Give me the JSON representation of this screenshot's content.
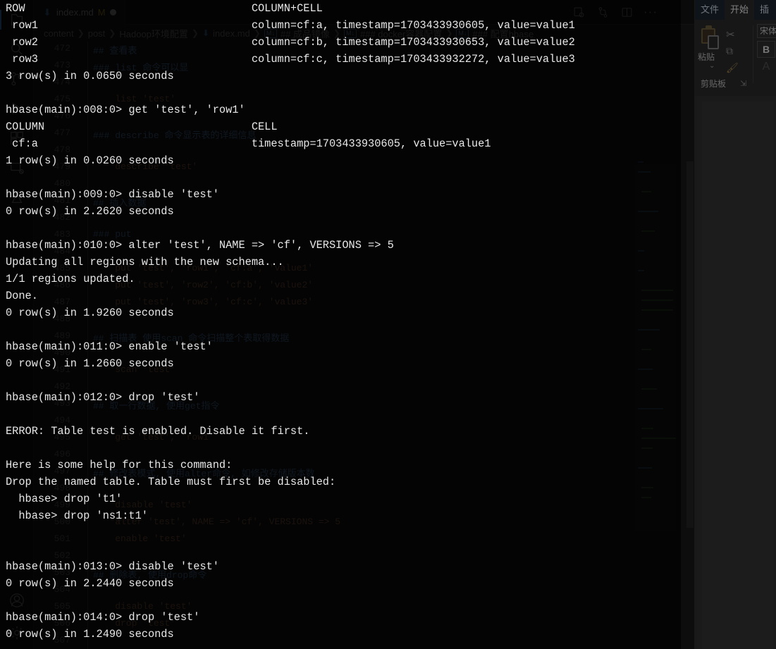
{
  "office": {
    "tabs": [
      {
        "label": "文件",
        "active": false
      },
      {
        "label": "开始",
        "active": true
      },
      {
        "label": "插",
        "active": false
      }
    ],
    "clipboard": {
      "paste_label": "粘贴",
      "paste_chevron": "⌄",
      "group_label": "剪贴板",
      "dialog_launcher": "⇲",
      "cut_icon": "scissors-icon",
      "copy_icon": "copy-icon",
      "format_painter_icon": "format-painter-icon"
    },
    "font": {
      "family_value": "宋体",
      "bold_label": "B",
      "font_color_label": "A"
    }
  },
  "vscode": {
    "activity_bar": {
      "items": [
        {
          "name": "explorer",
          "icon": "files-icon"
        },
        {
          "name": "search",
          "icon": "search-icon"
        },
        {
          "name": "source-control",
          "icon": "source-control-icon"
        },
        {
          "name": "run-debug",
          "icon": "run-debug-icon"
        },
        {
          "name": "extensions",
          "icon": "extensions-icon"
        },
        {
          "name": "remote-explorer",
          "icon": "remote-explorer-icon"
        },
        {
          "name": "testing",
          "icon": "beaker-icon"
        }
      ],
      "bottom_items": [
        {
          "name": "accounts",
          "icon": "account-icon"
        },
        {
          "name": "settings",
          "icon": "gear-icon"
        }
      ]
    },
    "tab": {
      "file_icon": "markdown-icon",
      "name": "index.md",
      "modified_badge": "M",
      "dirty_indicator": "●"
    },
    "editor_actions": [
      {
        "name": "open-preview",
        "icon": "preview-icon"
      },
      {
        "name": "source-control-graph",
        "icon": "git-compare-icon"
      },
      {
        "name": "split-editor",
        "icon": "split-editor-icon"
      },
      {
        "name": "more-actions",
        "icon": "ellipsis-icon",
        "label": "···"
      }
    ],
    "breadcrumb": [
      {
        "label": "content",
        "type": "folder"
      },
      {
        "label": "post",
        "type": "folder"
      },
      {
        "label": "Hadoop环境配置",
        "type": "folder"
      },
      {
        "label": "index.md",
        "type": "file"
      },
      {
        "label": "## 成品镜像",
        "type": "symbol"
      },
      {
        "label": "### docker容器配置",
        "type": "symbol"
      },
      {
        "label": "### 配置hbase",
        "type": "symbol"
      }
    ],
    "editor_lines": [
      {
        "num": "472",
        "text": "## 查看表",
        "cls": "c-head"
      },
      {
        "num": "473",
        "text": "### list 命令可以显",
        "cls": "c-head"
      },
      {
        "num": "474",
        "text": "",
        "cls": "c-txt"
      },
      {
        "num": "475",
        "text": "    list 'test'",
        "cls": "c-str"
      },
      {
        "num": "476",
        "text": "",
        "cls": "c-txt"
      },
      {
        "num": "477",
        "text": "### describe 命令显示表的详细信息",
        "cls": "c-head"
      },
      {
        "num": "478",
        "text": "",
        "cls": "c-txt"
      },
      {
        "num": "479",
        "text": "    describe 'test'",
        "cls": "c-str"
      },
      {
        "num": "480",
        "text": "",
        "cls": "c-txt"
      },
      {
        "num": "481",
        "text": "## 插入数据",
        "cls": "c-head"
      },
      {
        "num": "482",
        "text": "",
        "cls": "c-txt"
      },
      {
        "num": "483",
        "text": "### put",
        "cls": "c-head"
      },
      {
        "num": "484",
        "text": "",
        "cls": "c-txt"
      },
      {
        "num": "485",
        "text": "    put 'test', 'row1', 'cf:a', 'value1'",
        "cls": "c-str"
      },
      {
        "num": "486",
        "text": "    put 'test', 'row2', 'cf:b', 'value2'",
        "cls": "c-str"
      },
      {
        "num": "487",
        "text": "    put 'test', 'row3', 'cf:c', 'value3'",
        "cls": "c-str"
      },
      {
        "num": "488",
        "text": "",
        "cls": "c-txt"
      },
      {
        "num": "489",
        "text": "## 扫描表 使用scan 命令扫描整个表取得数据",
        "cls": "c-head"
      },
      {
        "num": "490",
        "text": "",
        "cls": "c-txt"
      },
      {
        "num": "491",
        "text": "    scan 'test'",
        "cls": "c-str"
      },
      {
        "num": "492",
        "text": "",
        "cls": "c-txt"
      },
      {
        "num": "493",
        "text": "## 取一行数据, 使用get指令",
        "cls": "c-head"
      },
      {
        "num": "494",
        "text": "",
        "cls": "c-txt"
      },
      {
        "num": "495",
        "text": "    get 'test', 'row1'",
        "cls": "c-str"
      },
      {
        "num": "496",
        "text": "",
        "cls": "c-txt"
      },
      {
        "num": "497",
        "text": "## 修改表模式, 使用alter命令, 如修改存储版本数",
        "cls": "c-head"
      },
      {
        "num": "498",
        "text": "",
        "cls": "c-txt"
      },
      {
        "num": "499",
        "text": "    disable 'test'",
        "cls": "c-str"
      },
      {
        "num": "500",
        "text": "    alter 'test', NAME => 'cf', VERSIONS => 5",
        "cls": "c-str"
      },
      {
        "num": "501",
        "text": "    enable 'test'",
        "cls": "c-str"
      },
      {
        "num": "502",
        "text": "",
        "cls": "c-txt"
      },
      {
        "num": "503",
        "text": "## 删除表, 使用drop命令",
        "cls": "c-head"
      },
      {
        "num": "504",
        "text": "",
        "cls": "c-txt"
      },
      {
        "num": "505",
        "text": "    disable 'test'",
        "cls": "c-str"
      },
      {
        "num": "506",
        "text": "    drop 'test'",
        "cls": "c-str"
      },
      {
        "num": "507",
        "text": "",
        "cls": "c-txt"
      }
    ]
  },
  "terminal": {
    "lines": [
      "ROW                                   COLUMN+CELL",
      " row1                                 column=cf:a, timestamp=1703433930605, value=value1",
      " row2                                 column=cf:b, timestamp=1703433930653, value=value2",
      " row3                                 column=cf:c, timestamp=1703433932272, value=value3",
      "3 row(s) in 0.0650 seconds",
      "",
      "hbase(main):008:0> get 'test', 'row1'",
      "COLUMN                                CELL",
      " cf:a                                 timestamp=1703433930605, value=value1",
      "1 row(s) in 0.0260 seconds",
      "",
      "hbase(main):009:0> disable 'test'",
      "0 row(s) in 2.2620 seconds",
      "",
      "hbase(main):010:0> alter 'test', NAME => 'cf', VERSIONS => 5",
      "Updating all regions with the new schema...",
      "1/1 regions updated.",
      "Done.",
      "0 row(s) in 1.9260 seconds",
      "",
      "hbase(main):011:0> enable 'test'",
      "0 row(s) in 1.2660 seconds",
      "",
      "hbase(main):012:0> drop 'test'",
      "",
      "ERROR: Table test is enabled. Disable it first.",
      "",
      "Here is some help for this command:",
      "Drop the named table. Table must first be disabled:",
      "  hbase> drop 't1'",
      "  hbase> drop 'ns1:t1'",
      "",
      "",
      "hbase(main):013:0> disable 'test'",
      "0 row(s) in 2.2440 seconds",
      "",
      "hbase(main):014:0> drop 'test'",
      "0 row(s) in 1.2490 seconds"
    ]
  }
}
